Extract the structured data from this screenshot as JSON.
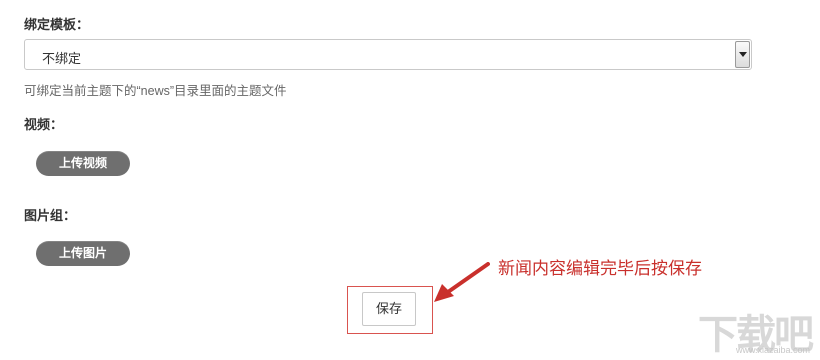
{
  "template": {
    "label": "绑定模板：",
    "selected": "不绑定",
    "hint": "可绑定当前主题下的“news”目录里面的主题文件"
  },
  "video": {
    "label": "视频：",
    "upload_label": "上传视频"
  },
  "gallery": {
    "label": "图片组：",
    "upload_label": "上传图片"
  },
  "save_label": "保存",
  "annotation": "新闻内容编辑完毕后按保存",
  "colors": {
    "annotation": "#c9302c",
    "pill_button": "#6f6f6f"
  },
  "watermark": {
    "text": "下载吧",
    "sub": "www.xiazaiba.com"
  }
}
